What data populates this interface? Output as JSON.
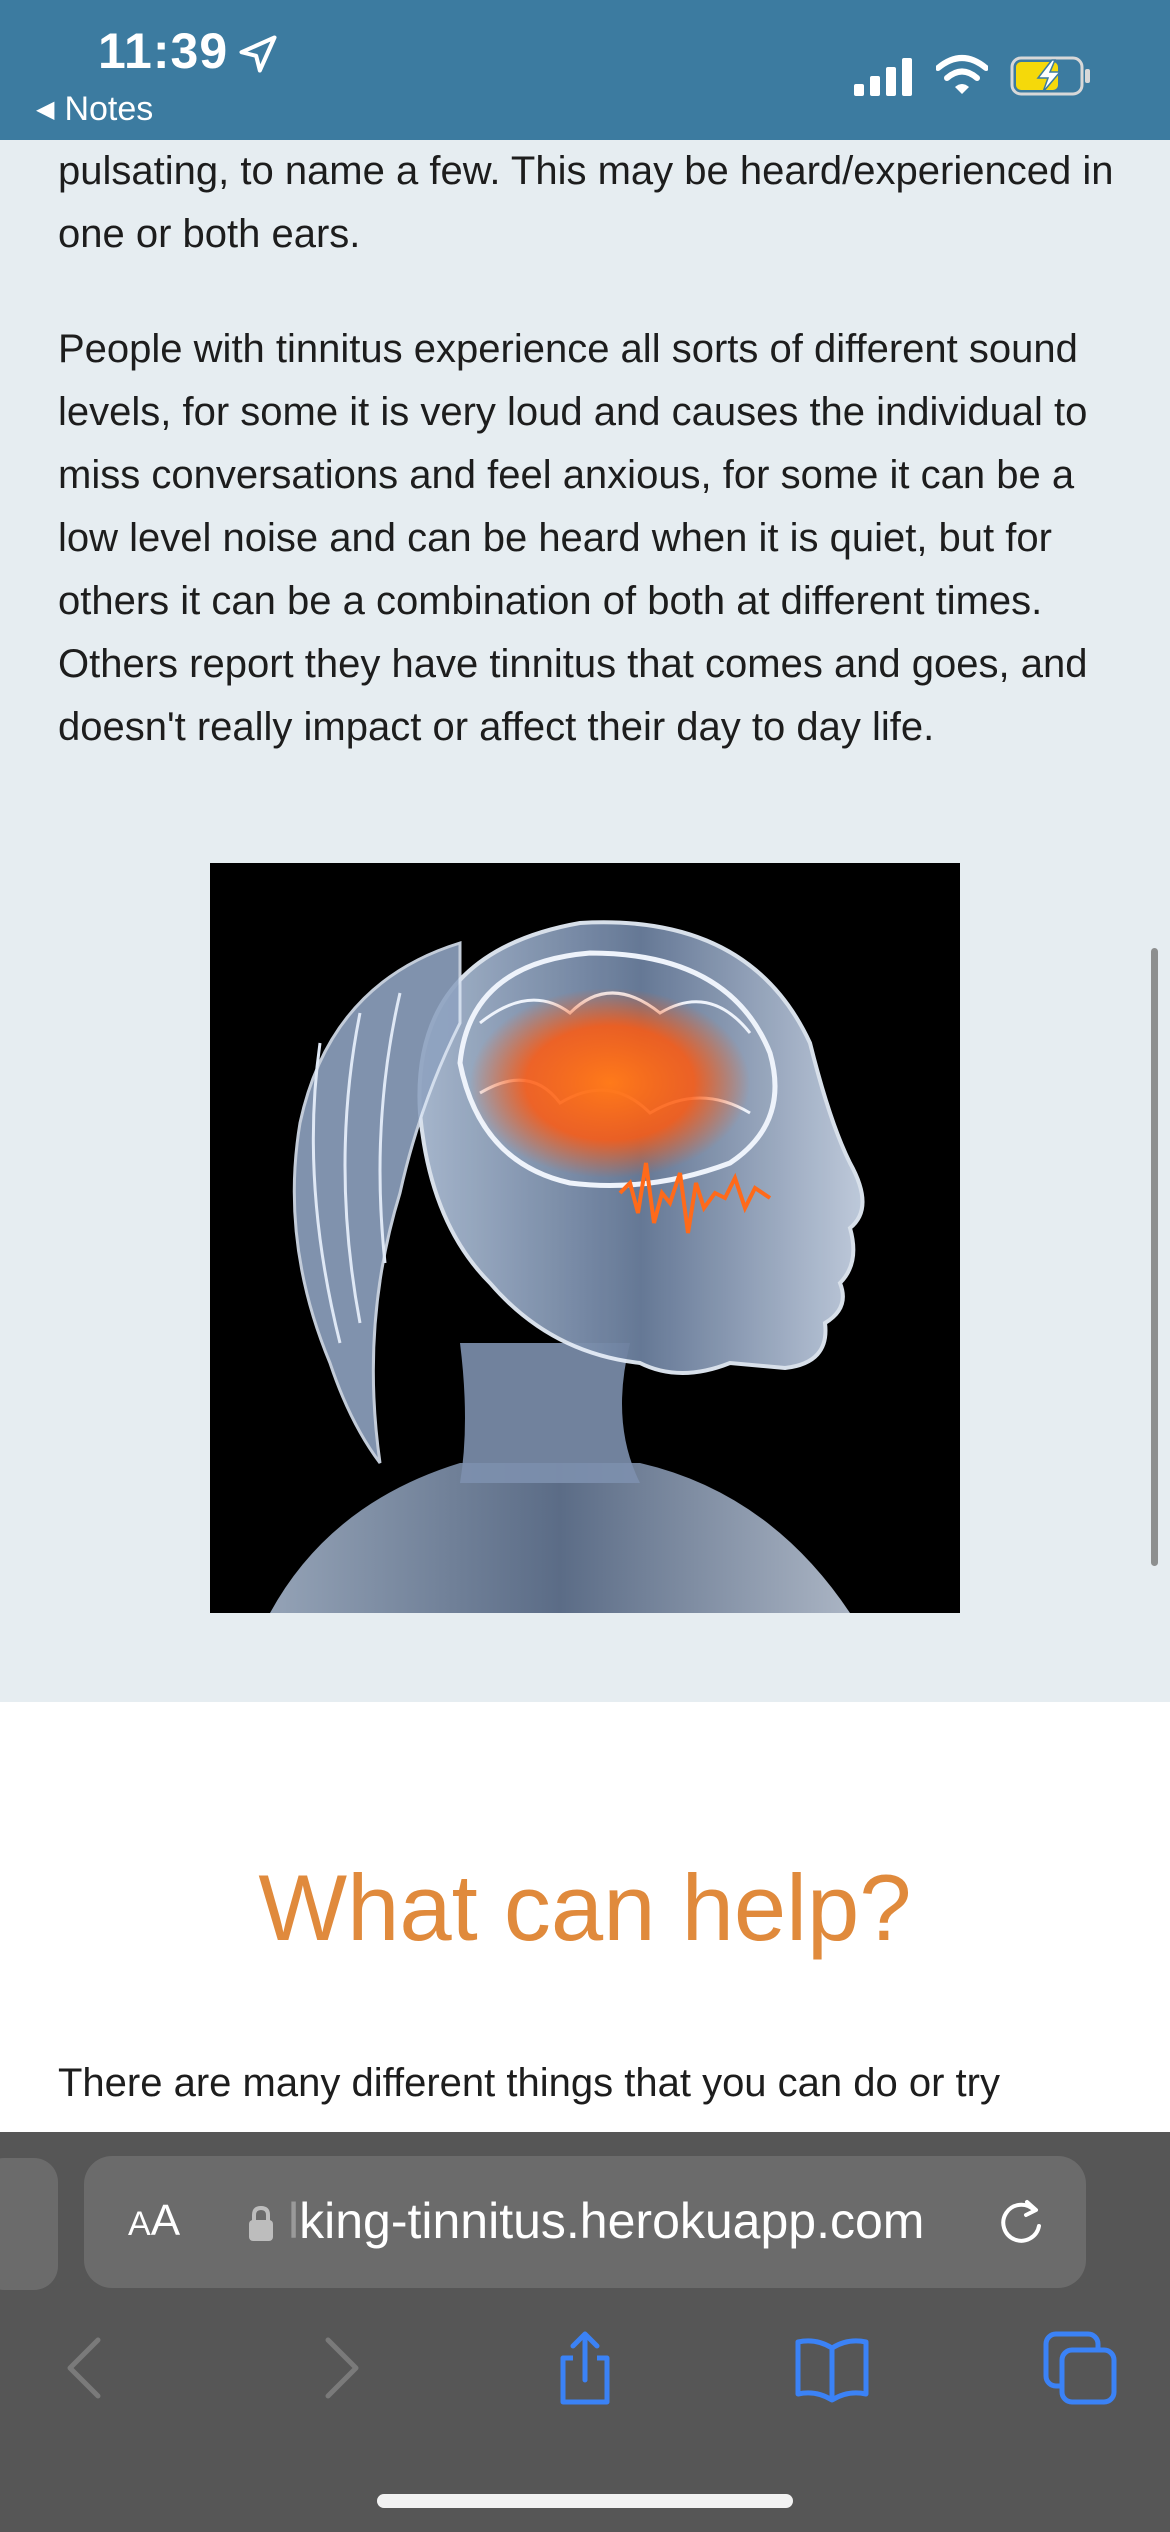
{
  "status_bar": {
    "time": "11:39",
    "back_label": "Notes",
    "icons": [
      "location-arrow-icon",
      "cellular-signal-icon",
      "wifi-icon",
      "battery-charging-icon"
    ],
    "bar_color": "#3c7ba0",
    "battery_color": "#f5d90a"
  },
  "article": {
    "para1": "pulsating, to name a few. This may be heard/experienced in one or both ears.",
    "para2": "People with tinnitus experience all sorts of different sound levels, for some it is very loud and causes the individual to miss conversations and feel anxious, for some it can be a low level noise and can be heard when it is quiet, but for others it can be a combination of both at different times. Others report they have tinnitus that comes and goes, and doesn't really impact or affect their day to day life.",
    "image_alt": "x-ray style head profile with glowing orange brain and sound wave"
  },
  "help_section": {
    "title": "What can help?",
    "intro": "There are many different things that you can do or try",
    "accent_color": "#e08a3c"
  },
  "browser": {
    "aa_small": "A",
    "aa_large": "A",
    "url_prefix": "l",
    "url": "king-tinnitus.herokuapp.com",
    "toolbar": [
      "back-icon",
      "forward-icon",
      "share-icon",
      "bookmarks-icon",
      "tabs-icon"
    ],
    "icon_color": "#3b82f6"
  }
}
